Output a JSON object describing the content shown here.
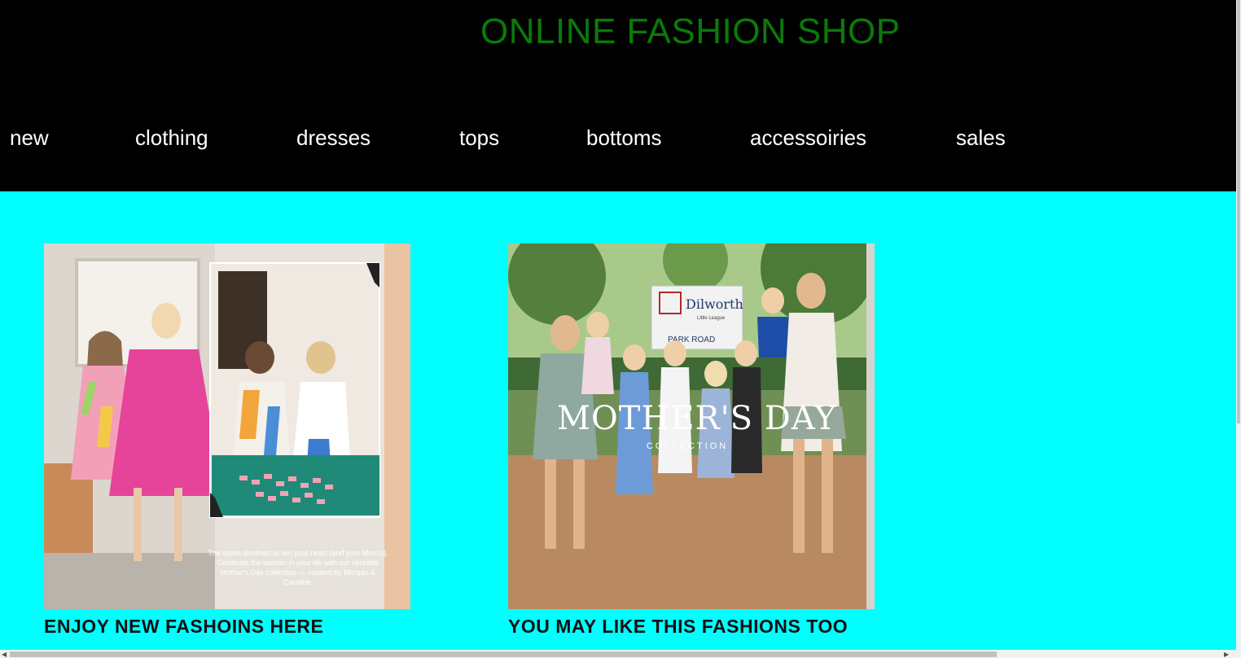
{
  "header": {
    "title": "ONLINE FASHION SHOP",
    "nav": [
      {
        "label": "new"
      },
      {
        "label": "clothing"
      },
      {
        "label": "dresses"
      },
      {
        "label": "tops"
      },
      {
        "label": "bottoms"
      },
      {
        "label": "accessoiries"
      },
      {
        "label": "sales"
      }
    ]
  },
  "cards": [
    {
      "caption": "ENJOY NEW FASHOINS HERE",
      "image_text": "The styles destined to win your heart (and your Mom's). Celebrate the women in your life with our versatile Mother's Day collection — curated by Morgan & Caroline."
    },
    {
      "caption": "YOU MAY LIKE THIS FASHIONS TOO",
      "image_title": "MOTHER'S DAY",
      "image_subtitle": "COLLECTION",
      "sign_name": "Dilworth",
      "sign_sub": "Little League",
      "sign_road": "PARK ROAD"
    }
  ],
  "colors": {
    "header_bg": "#000000",
    "title": "#0a7a0a",
    "nav_text": "#ffffff",
    "page_bg": "#00ffff",
    "caption": "#111111"
  }
}
